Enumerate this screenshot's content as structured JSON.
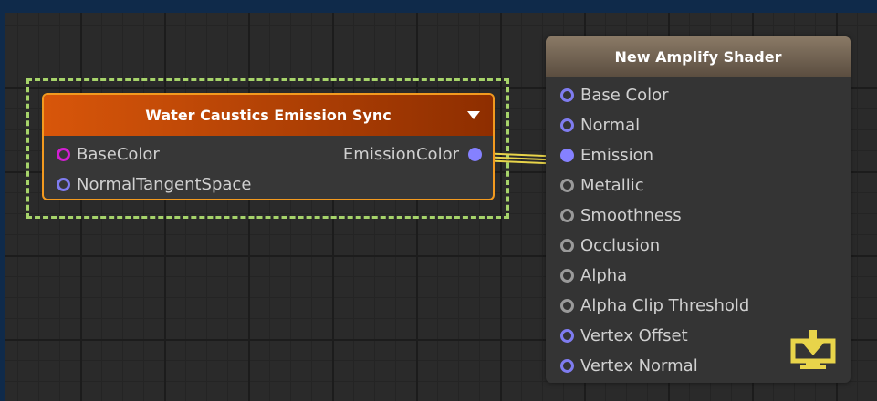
{
  "colors": {
    "accent_dash": "#a6d36a",
    "wire": "#e8d44a",
    "port_blue": "#7f7cf0",
    "port_magenta": "#d21fd2",
    "port_gray": "#9a9a9a",
    "node_orange": "#d8560a",
    "save_icon": "#e8d44a"
  },
  "left_node": {
    "title": "Water Caustics Emission Sync",
    "dropdown_icon": "chevron-down-icon",
    "inputs": [
      {
        "label": "BaseColor",
        "port_color": "magenta"
      },
      {
        "label": "NormalTangentSpace",
        "port_color": "blue"
      }
    ],
    "outputs": [
      {
        "label": "EmissionColor",
        "connected": true
      }
    ]
  },
  "right_node": {
    "title": "New Amplify Shader",
    "inputs": [
      {
        "label": "Base Color",
        "port_color": "blue"
      },
      {
        "label": "Normal",
        "port_color": "blue"
      },
      {
        "label": "Emission",
        "port_color": "blue",
        "connected": true
      },
      {
        "label": "Metallic",
        "port_color": "gray"
      },
      {
        "label": "Smoothness",
        "port_color": "gray"
      },
      {
        "label": "Occlusion",
        "port_color": "gray"
      },
      {
        "label": "Alpha",
        "port_color": "gray"
      },
      {
        "label": "Alpha Clip Threshold",
        "port_color": "gray"
      },
      {
        "label": "Vertex Offset",
        "port_color": "blue"
      },
      {
        "label": "Vertex Normal",
        "port_color": "blue"
      }
    ],
    "master_icon": "save-icon"
  }
}
